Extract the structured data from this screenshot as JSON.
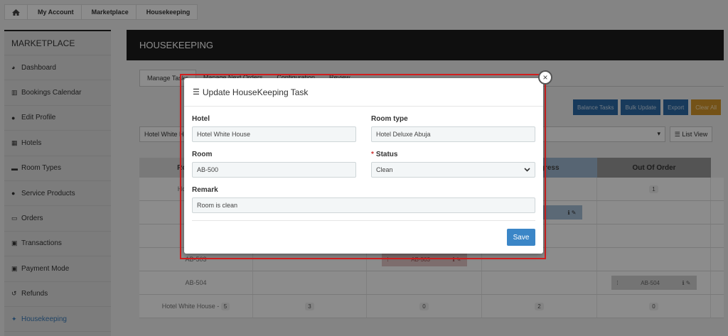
{
  "breadcrumb": {
    "home_icon": "home-icon",
    "items": [
      "My Account",
      "Marketplace",
      "Housekeeping"
    ]
  },
  "sidebar": {
    "title": "MARKETPLACE",
    "items": [
      {
        "icon": "dashboard-icon",
        "label": "Dashboard"
      },
      {
        "icon": "bar-chart-icon",
        "label": "Bookings Calendar"
      },
      {
        "icon": "user-icon",
        "label": "Edit Profile"
      },
      {
        "icon": "building-icon",
        "label": "Hotels"
      },
      {
        "icon": "bed-icon",
        "label": "Room Types"
      },
      {
        "icon": "users-icon",
        "label": "Service Products"
      },
      {
        "icon": "credit-card-icon",
        "label": "Orders"
      },
      {
        "icon": "money-icon",
        "label": "Transactions"
      },
      {
        "icon": "money-icon",
        "label": "Payment Mode"
      },
      {
        "icon": "undo-icon",
        "label": "Refunds"
      },
      {
        "icon": "housekeeping-icon",
        "label": "Housekeeping"
      }
    ]
  },
  "main": {
    "header": "HOUSEKEEPING",
    "tabs": [
      "Manage Tasks",
      "Manage Next Orders",
      "Configuration",
      "Review"
    ],
    "toolbar": [
      "Balance Tasks",
      "Bulk Update",
      "Export",
      "Clear All"
    ],
    "hotel_filter": "Hotel White House",
    "list_view": "List View",
    "grid": {
      "headers": [
        "Room Type",
        "",
        "",
        "In Progress",
        "Out Of Order"
      ],
      "rows": [
        {
          "label": "Hotel Deluxe",
          "c4": "1"
        },
        {
          "label": "AB-503",
          "chip": "AB-503"
        },
        {
          "label": "AB-504",
          "chip": "AB-504"
        },
        {
          "label": "Hotel White House -",
          "badge": "5",
          "c1": "3",
          "c2": "0",
          "c3": "2",
          "c4": "0"
        }
      ]
    }
  },
  "modal": {
    "title": "Update HouseKeeping Task",
    "hotel_label": "Hotel",
    "hotel_value": "Hotel White House",
    "room_type_label": "Room type",
    "room_type_value": "Hotel Deluxe Abuja",
    "room_label": "Room",
    "room_value": "AB-500",
    "status_label": "Status",
    "status_required": "*",
    "status_value": "Clean",
    "remark_label": "Remark",
    "remark_value": "Room is clean",
    "save_label": "Save"
  }
}
